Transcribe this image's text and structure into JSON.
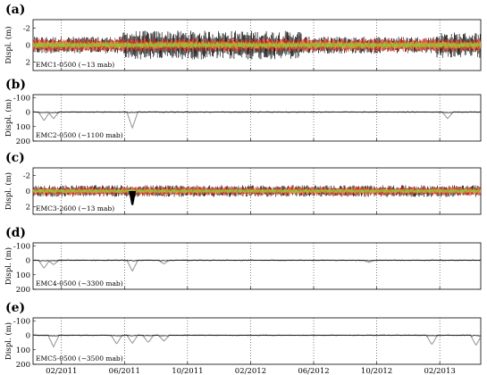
{
  "chart_data": {
    "type": "line",
    "x_ticks": [
      "02/2011",
      "06/2011",
      "10/2011",
      "02/2012",
      "06/2012",
      "10/2012",
      "02/2013"
    ],
    "grid": "vertical dotted at x ticks",
    "panels": [
      {
        "letter": "(a)",
        "ylabel": "Displ. (m)",
        "yticks": [
          "-2",
          "0",
          "2"
        ],
        "ylim": [
          -3,
          3
        ],
        "annotation": "EMC1-0500 (~13 mab)",
        "colors": {
          "main": "#000000",
          "secondary": "#e8231e",
          "tertiary": "#f2a81d",
          "quaternary": "#8cc63f"
        },
        "series_desc": "black, red, orange and green displacement traces, oscillating about 0",
        "typical_amplitude_m": 0.8
      },
      {
        "letter": "(b)",
        "ylabel": "Displ. (m)",
        "yticks": [
          "-100",
          "0",
          "100",
          "200"
        ],
        "ylim": [
          -120,
          200
        ],
        "annotation": "EMC2-0500 (~1100 mab)",
        "colors": {
          "main": "#000000",
          "secondary": "#9b9b9b"
        },
        "events": [
          {
            "t": "late 12/2010",
            "depth_m": 60
          },
          {
            "t": "01/2011",
            "depth_m": 45
          },
          {
            "t": "06/2011",
            "depth_m": 110
          },
          {
            "t": "02/2013",
            "depth_m": 45
          }
        ]
      },
      {
        "letter": "(c)",
        "ylabel": "Displ. (m)",
        "yticks": [
          "-2",
          "0",
          "2"
        ],
        "ylim": [
          -3,
          3
        ],
        "annotation": "EMC3-2600 (~13 mab)",
        "colors": {
          "main": "#000000",
          "secondary": "#e8231e",
          "tertiary": "#f2a81d",
          "quaternary": "#8cc63f"
        },
        "series_desc": "black, red, orange and green displacement traces, oscillating about 0",
        "typical_amplitude_m": 0.6,
        "events": [
          {
            "t": "06/2011",
            "depth_m": 1.8
          }
        ]
      },
      {
        "letter": "(d)",
        "ylabel": "Displ. (m)",
        "yticks": [
          "-100",
          "0",
          "100",
          "200"
        ],
        "ylim": [
          -120,
          200
        ],
        "annotation": "EMC4-0500 (~3300 mab)",
        "colors": {
          "main": "#000000",
          "secondary": "#9b9b9b"
        },
        "events": [
          {
            "t": "late 12/2010",
            "depth_m": 55
          },
          {
            "t": "01/2011",
            "depth_m": 30
          },
          {
            "t": "06/2011",
            "depth_m": 75
          },
          {
            "t": "08/2011",
            "depth_m": 25
          },
          {
            "t": "09/2012",
            "depth_m": 15
          }
        ]
      },
      {
        "letter": "(e)",
        "ylabel": "Displ. (m)",
        "yticks": [
          "-100",
          "0",
          "100",
          "200"
        ],
        "ylim": [
          -120,
          200
        ],
        "annotation": "EMC5-0500 (~3500 mab)",
        "colors": {
          "main": "#000000",
          "secondary": "#9b9b9b"
        },
        "events": [
          {
            "t": "01/2011",
            "depth_m": 80
          },
          {
            "t": "05/2011",
            "depth_m": 60
          },
          {
            "t": "06/2011",
            "depth_m": 55
          },
          {
            "t": "07/2011",
            "depth_m": 50
          },
          {
            "t": "08/2011",
            "depth_m": 40
          },
          {
            "t": "01/2013",
            "depth_m": 65
          },
          {
            "t": "late 03/2013",
            "depth_m": 70
          }
        ]
      }
    ]
  }
}
